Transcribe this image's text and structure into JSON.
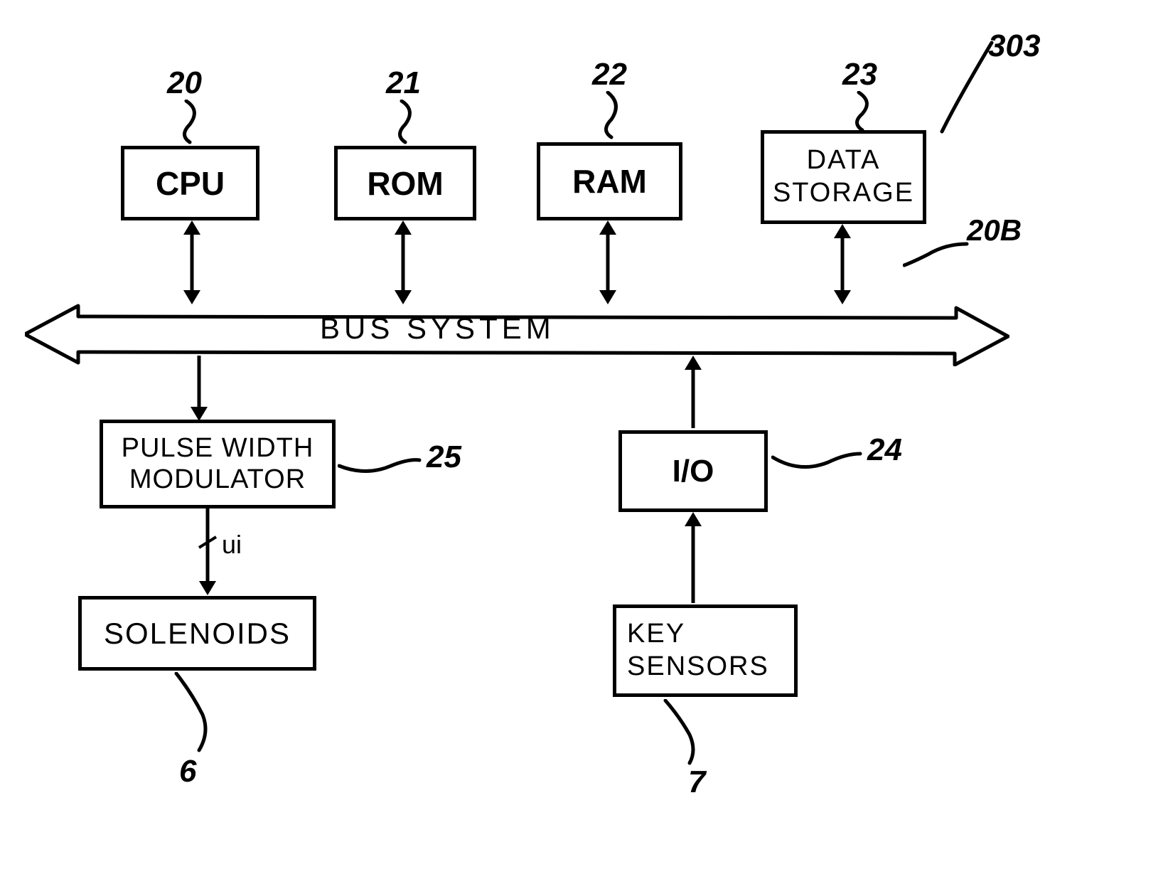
{
  "refs": {
    "cpu": "20",
    "rom": "21",
    "ram": "22",
    "storage": "23",
    "io": "24",
    "pwm": "25",
    "bus": "20B",
    "solenoids": "6",
    "sensors": "7",
    "top_right": "303"
  },
  "blocks": {
    "cpu": "CPU",
    "rom": "ROM",
    "ram": "RAM",
    "storage_line1": "DATA",
    "storage_line2": "STORAGE",
    "bus": "BUS   SYSTEM",
    "pwm_line1": "PULSE WIDTH",
    "pwm_line2": "MODULATOR",
    "io": "I/O",
    "solenoids": "SOLENOIDS",
    "sensors_line1": "KEY",
    "sensors_line2": "SENSORS",
    "ui": "ui"
  }
}
